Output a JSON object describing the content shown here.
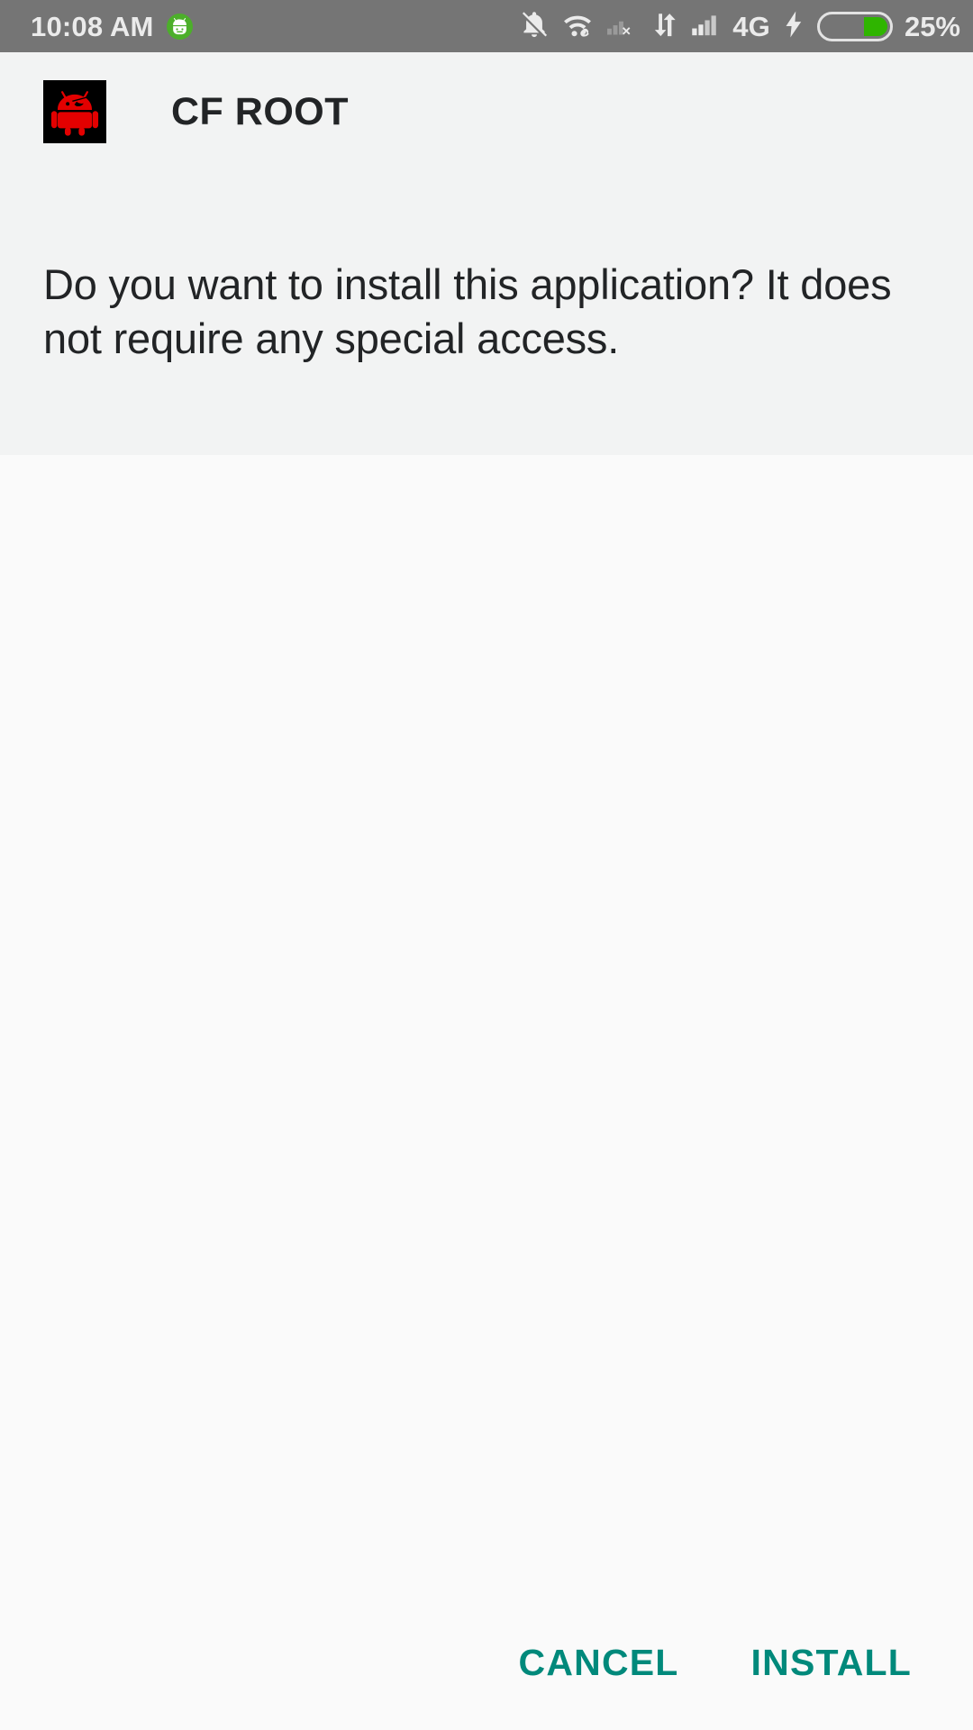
{
  "status_bar": {
    "time": "10:08 AM",
    "badge_icon": "android-head-badge-icon",
    "icons": [
      "notifications-off-icon",
      "wifi-connected-icon",
      "sim1-no-signal-icon",
      "data-transfer-icon",
      "sim2-signal-icon"
    ],
    "network_type": "4G",
    "charging_icon": "lightning-bolt-icon",
    "battery_percent": "25%",
    "battery_level": 25,
    "colors": {
      "background": "#757575",
      "text": "#ebebeb",
      "battery_fill": "#2fb500",
      "badge_background": "#4caf2a"
    }
  },
  "dialog": {
    "app_icon": "cf-root-red-android-icon",
    "app_name": "CF ROOT",
    "message": "Do you want to install this application? It does not require any special access.",
    "buttons": [
      {
        "label": "CANCEL",
        "name": "cancel-button"
      },
      {
        "label": "INSTALL",
        "name": "install-button"
      }
    ],
    "colors": {
      "header_background": "#f2f3f3",
      "body_background": "#fafafa",
      "text": "#222426",
      "accent": "#00897b",
      "icon_background": "#000000",
      "icon_red": "#e00000"
    }
  }
}
